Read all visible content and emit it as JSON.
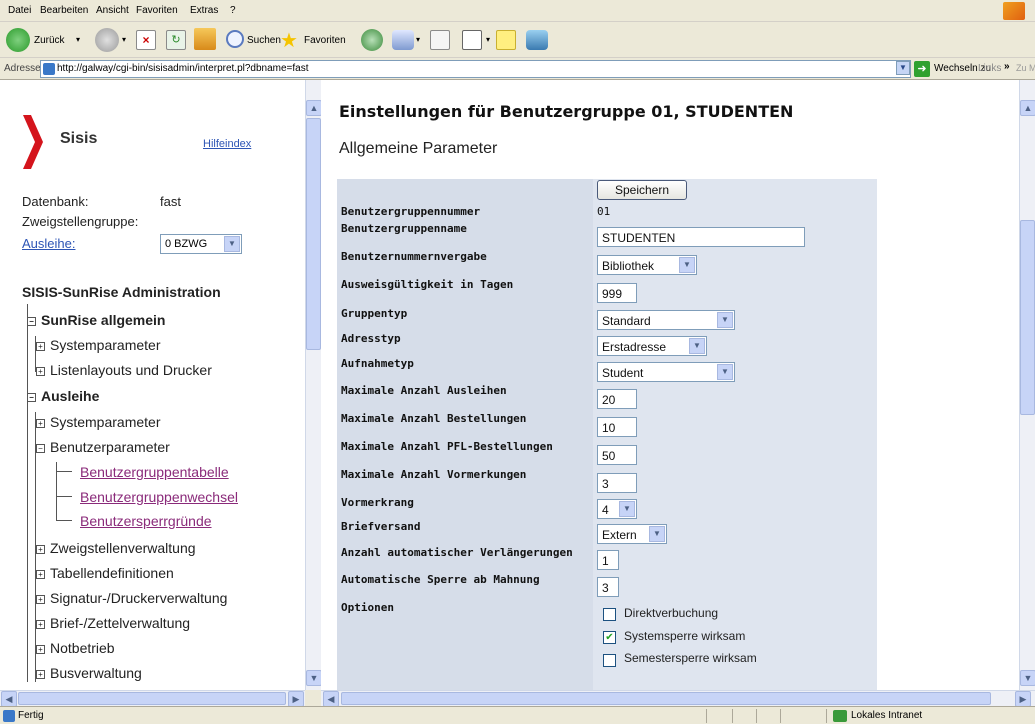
{
  "menu": [
    "Datei",
    "Bearbeiten",
    "Ansicht",
    "Favoriten",
    "Extras",
    "?"
  ],
  "toolbar": {
    "back_label": "Zurück",
    "search_label": "Suchen",
    "favorites_label": "Favoriten"
  },
  "address": {
    "label": "Adresse",
    "url": "http://galway/cgi-bin/sisisadmin/interpret.pl?dbname=fast",
    "go_label": "Wechseln zu",
    "links_label": "Links",
    "links_more": "»",
    "zumy": "Zu My"
  },
  "left": {
    "logo_text": "Sisis",
    "help_link": "Hilfeindex",
    "db_label": "Datenbank:",
    "db_value": "fast",
    "branchgroup_label": "Zweigstellengruppe:",
    "ausleihe_label": "Ausleihe:",
    "branch_select": "0 BZWG",
    "admin_title": "SISIS-SunRise Administration",
    "tree": {
      "sunrise": "SunRise allgemein",
      "sunrise_sys": "Systemparameter",
      "sunrise_lists": "Listenlayouts und Drucker",
      "ausleihe": "Ausleihe",
      "ausl_sys": "Systemparameter",
      "ausl_user": "Benutzerparameter",
      "link1": "Benutzergruppentabelle",
      "link2": "Benutzergruppenwechsel",
      "link3": "Benutzersperrgründe",
      "branches": "Zweigstellenverwaltung",
      "tables": "Tabellendefinitionen",
      "signatures": "Signatur-/Druckerverwaltung",
      "letters": "Brief-/Zettelverwaltung",
      "emergency": "Notbetrieb",
      "bus": "Busverwaltung"
    }
  },
  "right": {
    "title": "Einstellungen für Benutzergruppe 01, STUDENTEN",
    "section": "Allgemeine Parameter",
    "save_label": "Speichern",
    "fields": {
      "group_number_label": "Benutzergruppennummer",
      "group_number": "01",
      "group_name_label": "Benutzergruppenname",
      "group_name": "STUDENTEN",
      "number_assign_label": "Benutzernummernvergabe",
      "number_assign": "Bibliothek",
      "id_validity_label": "Ausweisgültigkeit in Tagen",
      "id_validity": "999",
      "group_type_label": "Gruppentyp",
      "group_type": "Standard",
      "address_type_label": "Adresstyp",
      "address_type": "Erstadresse",
      "admission_type_label": "Aufnahmetyp",
      "admission_type": "Student",
      "max_loans_label": "Maximale Anzahl Ausleihen",
      "max_loans": "20",
      "max_orders_label": "Maximale Anzahl Bestellungen",
      "max_orders": "10",
      "max_pfl_label": "Maximale Anzahl PFL-Bestellungen",
      "max_pfl": "50",
      "max_reservations_label": "Maximale Anzahl Vormerkungen",
      "max_reservations": "3",
      "reservation_rank_label": "Vormerkrang",
      "reservation_rank": "4",
      "letter_dispatch_label": "Briefversand",
      "letter_dispatch": "Extern",
      "auto_renewals_label": "Anzahl automatischer Verlängerungen",
      "auto_renewals": "1",
      "auto_block_label": "Automatische Sperre ab Mahnung",
      "auto_block": "3",
      "options_label": "Optionen"
    },
    "options": [
      {
        "label": "Direktverbuchung",
        "checked": false
      },
      {
        "label": "Systemsperre wirksam",
        "checked": true
      },
      {
        "label": "Semestersperre wirksam",
        "checked": false
      }
    ]
  },
  "status": {
    "text": "Fertig",
    "zone": "Lokales Intranet"
  }
}
